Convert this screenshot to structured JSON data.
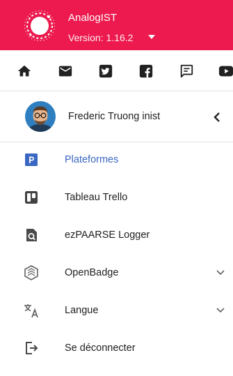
{
  "app": {
    "title": "AnalogIST",
    "version": "Version: 1.16.2"
  },
  "iconbar": [
    "home-icon",
    "mail-icon",
    "twitter-icon",
    "facebook-icon",
    "feedback-icon",
    "youtube-icon"
  ],
  "user": {
    "name": "Frederic Truong inist"
  },
  "menu": {
    "items": [
      {
        "label": "Plateformes",
        "icon": "p-badge-icon",
        "active": true
      },
      {
        "label": "Tableau Trello",
        "icon": "trello-icon"
      },
      {
        "label": "ezPAARSE Logger",
        "icon": "log-search-icon"
      },
      {
        "label": "OpenBadge",
        "icon": "badge-icon",
        "expandable": true
      },
      {
        "label": "Langue",
        "icon": "translate-icon",
        "expandable": true
      },
      {
        "label": "Se déconnecter",
        "icon": "logout-icon"
      }
    ]
  },
  "colors": {
    "header_bg": "#ec1a4e",
    "active_text": "#3a67c2",
    "badge_blue": "#3a67c2",
    "icon_dark": "#212121",
    "icon_grey": "#616161"
  }
}
